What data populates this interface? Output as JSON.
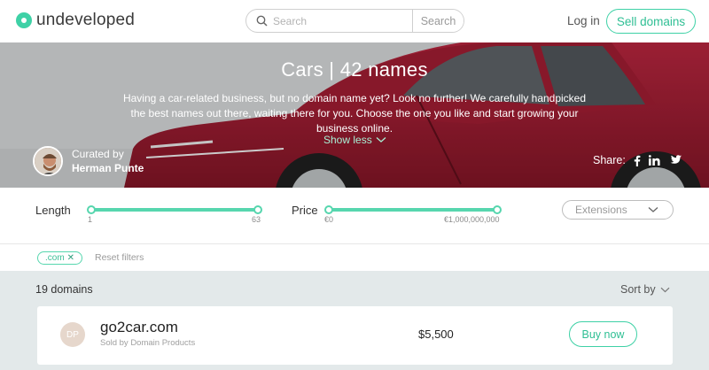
{
  "brand": {
    "name": "undeveloped",
    "accent": "#3ed1a6"
  },
  "search": {
    "placeholder": "Search",
    "button_label": "Search"
  },
  "nav": {
    "login_label": "Log in",
    "sell_label": "Sell domains"
  },
  "hero": {
    "title": "Cars | 42 names",
    "description": "Having a car-related business, but no domain name yet? Look no further! We carefully handpicked the best names out there, waiting there for you. Choose the one you like and start growing your business online.",
    "show_less_label": "Show less",
    "curated_by_label": "Curated by",
    "curator_name": "Herman Punte",
    "share_label": "Share:",
    "share_icons": [
      "facebook-icon",
      "linkedin-icon",
      "twitter-icon"
    ]
  },
  "filters": {
    "length": {
      "label": "Length",
      "min": "1",
      "max": "63"
    },
    "price": {
      "label": "Price",
      "min": "€0",
      "max": "€1,000,000,000"
    },
    "extensions_placeholder": "Extensions"
  },
  "chips": {
    "active": [
      ".com"
    ],
    "reset_label": "Reset filters"
  },
  "results": {
    "count_label": "19 domains",
    "sort_label": "Sort by",
    "items": [
      {
        "initials": "DP",
        "domain": "go2car.com",
        "seller": "Sold by Domain Products",
        "price": "$5,500",
        "buy_label": "Buy now"
      }
    ]
  }
}
